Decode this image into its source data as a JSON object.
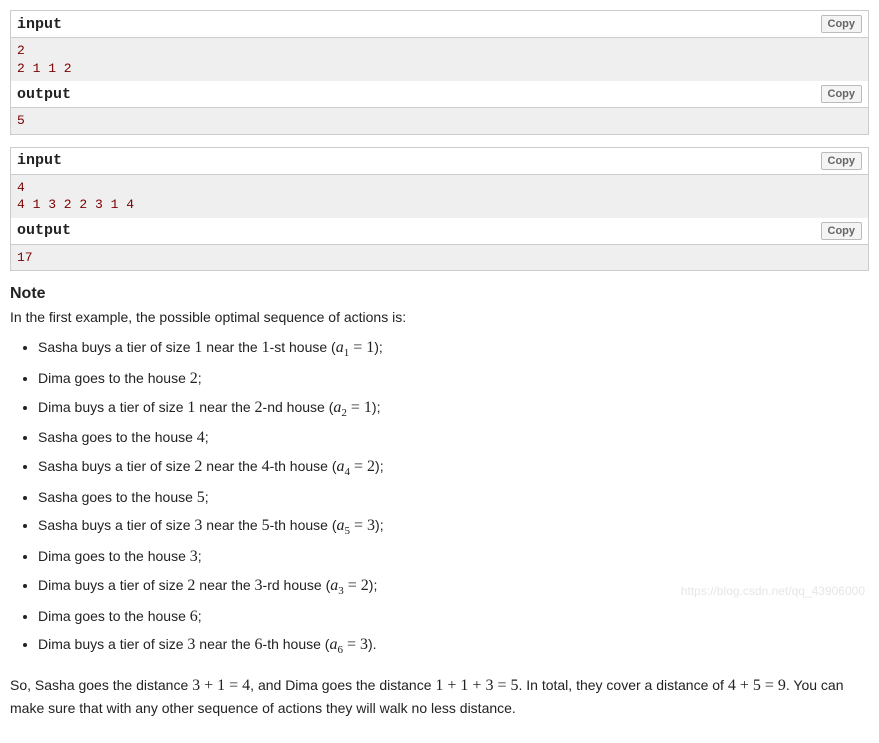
{
  "examples": [
    {
      "input": "2\n2 1 1 2",
      "output": "5"
    },
    {
      "input": "4\n4 1 3 2 2 3 1 4",
      "output": "17"
    }
  ],
  "labels": {
    "input": "input",
    "output": "output",
    "copy": "Copy"
  },
  "note": {
    "title": "Note",
    "intro": "In the first example, the possible optimal sequence of actions is:",
    "steps": [
      {
        "pre": "Sasha buys a tier of size ",
        "n1": "1",
        "mid": " near the ",
        "n2": "1",
        "suffix": "-st house (",
        "aidx": "1",
        "aval": "1",
        "type": "buy"
      },
      {
        "pre": "Dima goes to the house ",
        "n1": "2",
        "type": "go"
      },
      {
        "pre": "Dima buys a tier of size ",
        "n1": "1",
        "mid": " near the ",
        "n2": "2",
        "suffix": "-nd house (",
        "aidx": "2",
        "aval": "1",
        "type": "buy"
      },
      {
        "pre": "Sasha goes to the house ",
        "n1": "4",
        "type": "go"
      },
      {
        "pre": "Sasha buys a tier of size ",
        "n1": "2",
        "mid": " near the ",
        "n2": "4",
        "suffix": "-th house (",
        "aidx": "4",
        "aval": "2",
        "type": "buy"
      },
      {
        "pre": "Sasha goes to the house ",
        "n1": "5",
        "type": "go"
      },
      {
        "pre": "Sasha buys a tier of size ",
        "n1": "3",
        "mid": " near the ",
        "n2": "5",
        "suffix": "-th house (",
        "aidx": "5",
        "aval": "3",
        "type": "buy"
      },
      {
        "pre": "Dima goes to the house ",
        "n1": "3",
        "type": "go"
      },
      {
        "pre": "Dima buys a tier of size ",
        "n1": "2",
        "mid": " near the ",
        "n2": "3",
        "suffix": "-rd house (",
        "aidx": "3",
        "aval": "2",
        "type": "buy"
      },
      {
        "pre": "Dima goes to the house ",
        "n1": "6",
        "type": "go"
      },
      {
        "pre": "Dima buys a tier of size ",
        "n1": "3",
        "mid": " near the ",
        "n2": "6",
        "suffix": "-th house (",
        "aidx": "6",
        "aval": "3",
        "type": "buy"
      }
    ],
    "closing": {
      "t1": "So, Sasha goes the distance ",
      "eq1": "3 + 1 = 4",
      "t2": ", and Dima goes the distance ",
      "eq2": "1 + 1 + 3 = 5",
      "t3": ". In total, they cover a distance of ",
      "eq3": "4 + 5 = 9",
      "t4": ". You can make sure that with any other sequence of actions they will walk no less distance."
    }
  },
  "watermark": "https://blog.csdn.net/qq_43906000"
}
